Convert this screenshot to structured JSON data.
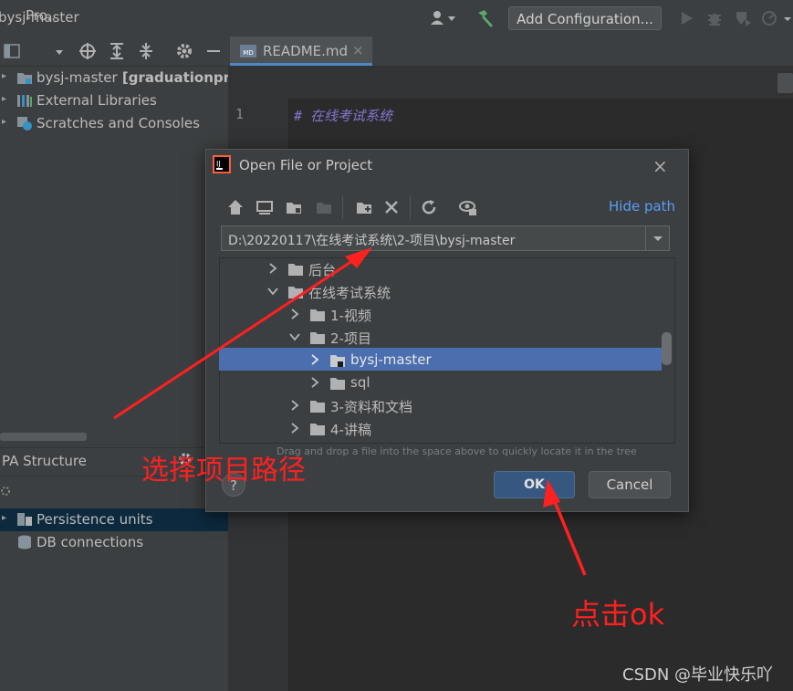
{
  "window": {
    "title": "bysj-master"
  },
  "toolbar": {
    "add_configuration": "Add Configuration..."
  },
  "project_panel": {
    "header_label": "Pro..",
    "items": [
      {
        "name": "bysj-master",
        "bold_suffix": " [graduationproj"
      },
      {
        "name": "External Libraries"
      },
      {
        "name": "Scratches and Consoles"
      }
    ]
  },
  "jpa_panel": {
    "title": "PA Structure",
    "items": [
      {
        "name": "Persistence units"
      },
      {
        "name": "DB connections"
      }
    ]
  },
  "editor": {
    "tab_label": "README.md",
    "tab_close": "×",
    "lines": [
      {
        "number": "1",
        "text": "#  在线考试系统"
      }
    ]
  },
  "dialog": {
    "title": "Open File or Project",
    "close": "×",
    "hide_path": "Hide path",
    "path": "D:\\20220117\\在线考试系统\\2-项目\\bysj-master",
    "tree": [
      {
        "label": "后台"
      },
      {
        "label": "在线考试系统"
      },
      {
        "label": "1-视频"
      },
      {
        "label": "2-项目"
      },
      {
        "label": "bysj-master"
      },
      {
        "label": "sql"
      },
      {
        "label": "3-资料和文档"
      },
      {
        "label": "4-讲稿"
      }
    ],
    "drag_hint": "Drag and drop a file into the space above to quickly locate it in the tree",
    "help": "?",
    "ok": "OK",
    "cancel": "Cancel"
  },
  "annotations": {
    "select_path": "选择项目路径",
    "click_ok": "点击ok",
    "watermark": "CSDN @毕业快乐吖"
  },
  "colors": {
    "selection": "#4b6eaf",
    "link": "#589df6",
    "annotation": "#ff2020",
    "primary_button": "#365880"
  }
}
